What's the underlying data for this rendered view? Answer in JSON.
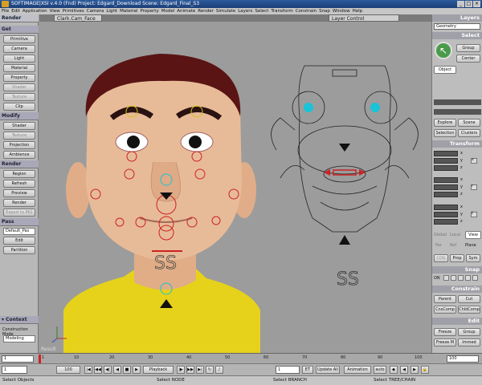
{
  "title": "SOFTIMAGE|XSI v.4.0 (Fnd) Project: Edgard_Download   Scene: Edgard_Final_S3",
  "window_controls": [
    "_",
    "□",
    "×"
  ],
  "menu": [
    "File",
    "Edit",
    "Application",
    "View",
    "Primitives",
    "Camera",
    "Light",
    "Material",
    "Property",
    "Model",
    "Animate",
    "Render",
    "Simulate",
    "Layers",
    "Select",
    "Transform",
    "Constrain",
    "Snap",
    "Window",
    "Help"
  ],
  "left_panel": {
    "header": "Render",
    "get": {
      "label": "Get",
      "items": [
        "Primitive",
        "Camera",
        "Light",
        "Material",
        "Property",
        "Shader",
        "Texture",
        "Clip"
      ]
    },
    "modify": {
      "label": "Modify",
      "items": [
        "Shader",
        "Texture",
        "Projection",
        "Ambience"
      ]
    },
    "render": {
      "label": "Render",
      "items": [
        "Region",
        "Refresh",
        "Preview",
        "Render",
        "Export to MI2"
      ]
    },
    "pass": {
      "label": "Pass",
      "field": "Default_Pas",
      "items": [
        "Edit",
        "Partition"
      ]
    },
    "context": {
      "label": "Context",
      "mode_label": "Construction Mode",
      "mode_value": "Modeling"
    }
  },
  "viewport": {
    "left_title": "Clark.Cam_Face",
    "right_title": "Layer Control",
    "corner_label": "Result",
    "ss_label": "SS"
  },
  "right_panel": {
    "layers": {
      "label": "Layers",
      "dropdown": "Geometry"
    },
    "select": {
      "label": "Select",
      "group": "Group",
      "center": "Center",
      "object": "Object",
      "explore": "Explore",
      "scene": "Scene",
      "selection": "Selection",
      "clusters": "Clusters"
    },
    "transform": {
      "label": "Transform",
      "axes": [
        "x",
        "y",
        "z"
      ],
      "side": [
        "s",
        "r",
        "t"
      ],
      "modes": [
        "Global",
        "Local",
        "View"
      ],
      "ref": [
        "Par",
        "Ref",
        "Plane"
      ],
      "cog": "COG",
      "prop": "Prop",
      "sym": "Sym"
    },
    "snap": {
      "label": "Snap",
      "on": "ON"
    },
    "constrain": {
      "label": "Constrain",
      "parent": "Parent",
      "cut": "Cut",
      "cnscomp": "CnsComp",
      "childcomp": "ChldComp"
    },
    "edit": {
      "label": "Edit",
      "freeze": "Freeze",
      "group": "Group",
      "freeze_m": "Freeze M",
      "immed": "Immed"
    }
  },
  "timeline": {
    "ticks": [
      "1",
      "10",
      "20",
      "30",
      "40",
      "50",
      "60",
      "70",
      "80",
      "90",
      "100"
    ],
    "end_value": "100"
  },
  "playbar": {
    "start_value": "1",
    "current_frame": "1",
    "end": "100",
    "playback": "Playback",
    "frame_field": "1",
    "et": "ET",
    "update": "Update All",
    "animation": "Animation",
    "auto": "auto"
  },
  "statusbar": {
    "select_objects": "Select Objects",
    "select_node": "Select NODE",
    "select_branch": "Select BRANCH",
    "select_tree": "Select TREE/CHAIN"
  },
  "colors": {
    "title_bg": "#1c3f78",
    "viewport_bg": "#9c9c9c",
    "jacket": "#e6d21a",
    "skin": "#e7b996",
    "hair": "#5a1414",
    "control_red": "#cc2222",
    "control_cyan": "#19c3d8"
  }
}
